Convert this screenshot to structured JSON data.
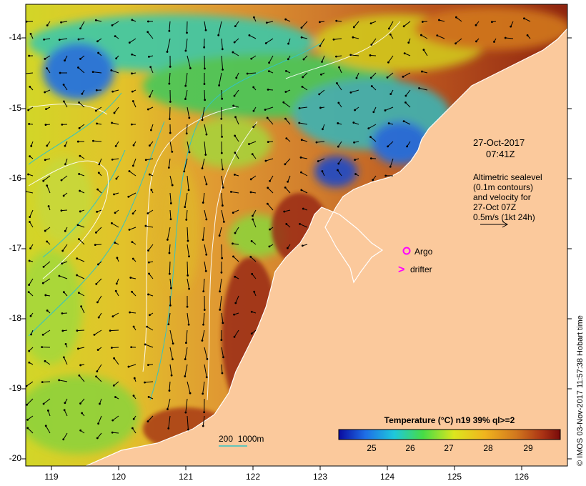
{
  "axes": {
    "y_ticks": [
      "-14",
      "-15",
      "-16",
      "-17",
      "-18",
      "-19",
      "-20"
    ],
    "x_ticks": [
      "119",
      "120",
      "121",
      "122",
      "123",
      "124",
      "125",
      "126"
    ]
  },
  "annotations": {
    "date": "27-Oct-2017",
    "time": "07:41Z",
    "altimetry_lines": [
      "Altimetric sealevel",
      "(0.1m contours)",
      "and velocity for",
      "27-Oct 07Z",
      "0.5m/s (1kt 24h)"
    ],
    "argo_label": "Argo",
    "drifter_label": "drifter",
    "drifter_symbol": ">",
    "depth_label": "200  1000m"
  },
  "colorbar": {
    "title": "Temperature (°C) n19 39% ql>=2",
    "ticks": [
      "25",
      "26",
      "27",
      "28",
      "29"
    ],
    "colors": [
      "#0a0aa0",
      "#1e6ee6",
      "#1ec8dc",
      "#46dc46",
      "#dce61e",
      "#f0b41e",
      "#d2781e",
      "#aa3214",
      "#780a0a"
    ]
  },
  "credit": "© IMOS 03-Nov-2017 11:57:38 Hobart time",
  "map_colors": {
    "land": "#fbc99c",
    "coast": "#ffffff",
    "contour_shelf": "#33c4c4",
    "contour_sealevel": "#ffffff",
    "argo": "#ff00ff",
    "drifter": "#ff00ff"
  }
}
